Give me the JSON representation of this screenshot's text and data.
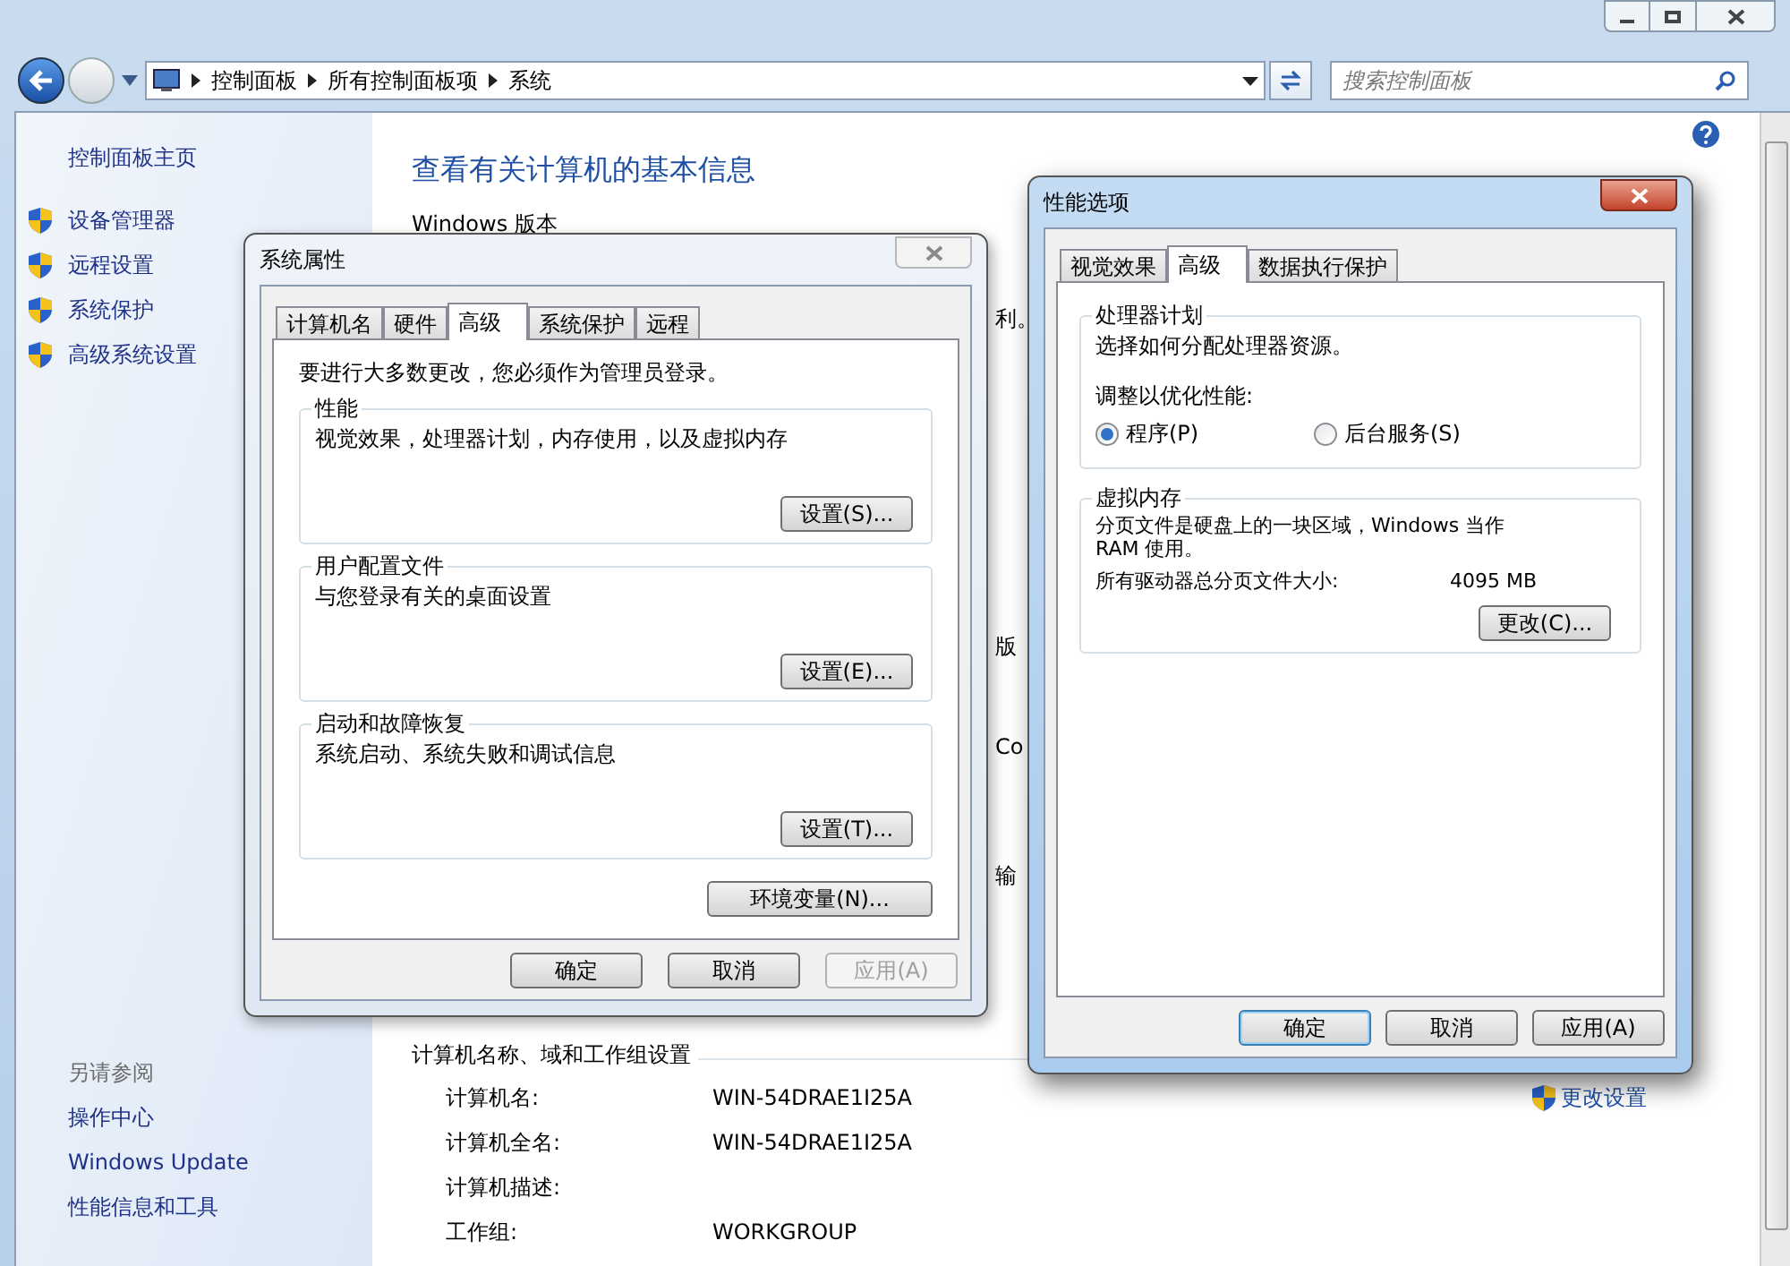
{
  "address_bar": {
    "breadcrumbs": [
      "控制面板",
      "所有控制面板项",
      "系统"
    ]
  },
  "search": {
    "placeholder": "搜索控制面板"
  },
  "sidebar": {
    "home": "控制面板主页",
    "items": [
      "设备管理器",
      "远程设置",
      "系统保护",
      "高级系统设置"
    ],
    "see_also_title": "另请参阅",
    "see_also": [
      "操作中心",
      "Windows Update",
      "性能信息和工具"
    ]
  },
  "main": {
    "heading": "查看有关计算机的基本信息",
    "section": "Windows 版本",
    "fragments": [
      "利。",
      "版",
      "Co",
      "输"
    ],
    "name_section": {
      "title": "计算机名称、域和工作组设置",
      "rows": [
        {
          "label": "计算机名:",
          "value": "WIN-54DRAE1I25A"
        },
        {
          "label": "计算机全名:",
          "value": "WIN-54DRAE1I25A"
        },
        {
          "label": "计算机描述:"
        },
        {
          "label": "工作组:",
          "value": "WORKGROUP"
        }
      ],
      "change_link": "更改设置"
    }
  },
  "system_properties": {
    "title": "系统属性",
    "active": false,
    "tabs": [
      {
        "label": "计算机名",
        "selected": false
      },
      {
        "label": "硬件",
        "selected": false
      },
      {
        "label": "高级",
        "selected": true
      },
      {
        "label": "系统保护",
        "selected": false
      },
      {
        "label": "远程",
        "selected": false
      }
    ],
    "note": "要进行大多数更改，您必须作为管理员登录。",
    "groups": [
      {
        "title": "性能",
        "description": "视觉效果，处理器计划，内存使用，以及虚拟内存",
        "button": "设置(S)..."
      },
      {
        "title": "用户配置文件",
        "description": "与您登录有关的桌面设置",
        "button": "设置(E)..."
      },
      {
        "title": "启动和故障恢复",
        "description": "系统启动、系统失败和调试信息",
        "button": "设置(T)..."
      }
    ],
    "env_button": "环境变量(N)...",
    "buttons": [
      {
        "label": "确定",
        "disabled": false
      },
      {
        "label": "取消",
        "disabled": false
      },
      {
        "label": "应用(A)",
        "disabled": true
      }
    ]
  },
  "performance_options": {
    "title": "性能选项",
    "active": true,
    "tabs": [
      {
        "label": "视觉效果",
        "selected": false
      },
      {
        "label": "高级",
        "selected": true
      },
      {
        "label": "数据执行保护",
        "selected": false
      }
    ],
    "processor": {
      "title": "处理器计划",
      "description": "选择如何分配处理器资源。",
      "prompt": "调整以优化性能:",
      "options": [
        {
          "label": "程序(P)",
          "selected": true
        },
        {
          "label": "后台服务(S)",
          "selected": false
        }
      ]
    },
    "virtual_memory": {
      "title": "虚拟内存",
      "description": "分页文件是硬盘上的一块区域，Windows 当作 RAM 使用。",
      "total_label": "所有驱动器总分页文件大小:",
      "total_value": "4095 MB",
      "button": "更改(C)..."
    },
    "buttons": [
      {
        "label": "确定",
        "default": true
      },
      {
        "label": "取消",
        "default": false
      },
      {
        "label": "应用(A)",
        "default": false
      }
    ]
  }
}
